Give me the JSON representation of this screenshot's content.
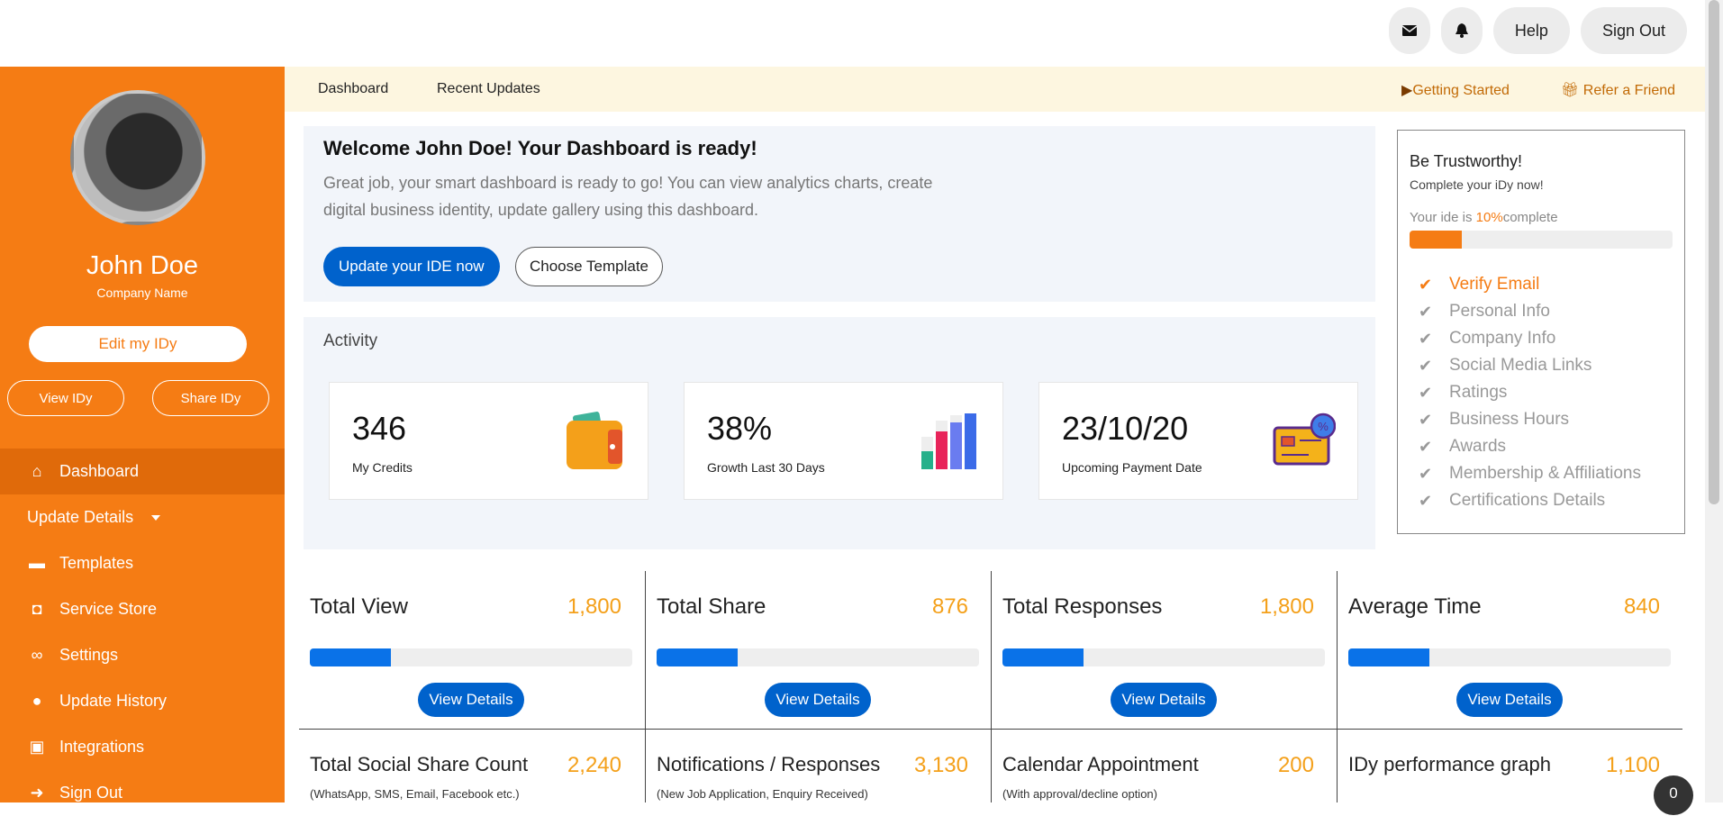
{
  "topbar": {
    "mail_icon": "mail-icon",
    "bell_icon": "bell-icon",
    "help_label": "Help",
    "signout_label": "Sign Out"
  },
  "sidebar": {
    "user_name": "John Doe",
    "company_name": "Company Name",
    "edit_label": "Edit my IDy",
    "view_label": "View IDy",
    "share_label": "Share IDy",
    "items": [
      {
        "label": "Dashboard",
        "icon": "home-icon"
      },
      {
        "label": "Update Details",
        "icon": ""
      },
      {
        "label": "Templates",
        "icon": "card-icon"
      },
      {
        "label": "Service Store",
        "icon": "gift-icon"
      },
      {
        "label": "Settings",
        "icon": "link-icon"
      },
      {
        "label": "Update History",
        "icon": "user-icon"
      },
      {
        "label": "Integrations",
        "icon": "integrations-icon"
      },
      {
        "label": "Sign Out",
        "icon": "sign-out-icon"
      }
    ]
  },
  "subnav": {
    "dashboard": "Dashboard",
    "recent": "Recent Updates",
    "getting_started": "Getting Started",
    "refer": "Refer a Friend"
  },
  "welcome": {
    "title": "Welcome John Doe! Your Dashboard is ready!",
    "text": "Great job, your smart dashboard is ready to go! You can view analytics charts, create digital business identity, update gallery using this dashboard.",
    "update_btn": "Update your IDE now",
    "template_btn": "Choose Template"
  },
  "activity": {
    "title": "Activity",
    "cards": [
      {
        "value": "346",
        "label": "My Credits",
        "icon": "wallet-icon"
      },
      {
        "value": "38%",
        "label": "Growth Last 30 Days",
        "icon": "bar-chart-icon"
      },
      {
        "value": "23/10/20",
        "label": "Upcoming Payment Date",
        "icon": "payment-card-icon"
      }
    ]
  },
  "trust": {
    "title": "Be Trustworthy!",
    "subtitle": "Complete your iDy now!",
    "progress_prefix": "Your ide is ",
    "progress_pct": "10%",
    "progress_suffix": "complete",
    "progress_value": 0.2,
    "items": [
      {
        "label": "Verify Email",
        "done": true
      },
      {
        "label": "Personal Info",
        "done": false
      },
      {
        "label": "Company Info",
        "done": false
      },
      {
        "label": "Social Media Links",
        "done": false
      },
      {
        "label": "Ratings",
        "done": false
      },
      {
        "label": "Business Hours",
        "done": false
      },
      {
        "label": "Awards",
        "done": false
      },
      {
        "label": "Membership & Affiliations",
        "done": false
      },
      {
        "label": "Certifications Details",
        "done": false
      }
    ]
  },
  "metrics": [
    {
      "title": "Total View",
      "value": "1,800",
      "progress": 0.25,
      "button": "View Details"
    },
    {
      "title": "Total Share",
      "value": "876",
      "progress": 0.25,
      "button": "View Details"
    },
    {
      "title": "Total Responses",
      "value": "1,800",
      "progress": 0.25,
      "button": "View Details"
    },
    {
      "title": "Average Time",
      "value": "840",
      "progress": 0.25,
      "button": "View Details"
    }
  ],
  "metrics2": [
    {
      "title": "Total Social Share Count",
      "value": "2,240",
      "sub": "(WhatsApp, SMS, Email, Facebook etc.)"
    },
    {
      "title": "Notifications / Responses",
      "value": "3,130",
      "sub": "(New Job Application, Enquiry Received)"
    },
    {
      "title": "Calendar Appointment",
      "value": "200",
      "sub": "(With approval/decline option)"
    },
    {
      "title": "IDy performance graph",
      "value": "1,100",
      "sub": ""
    }
  ],
  "chat_badge": "0",
  "colors": {
    "brand": "#f57c14",
    "primary": "#0062cc",
    "accent": "#f4a01a"
  }
}
